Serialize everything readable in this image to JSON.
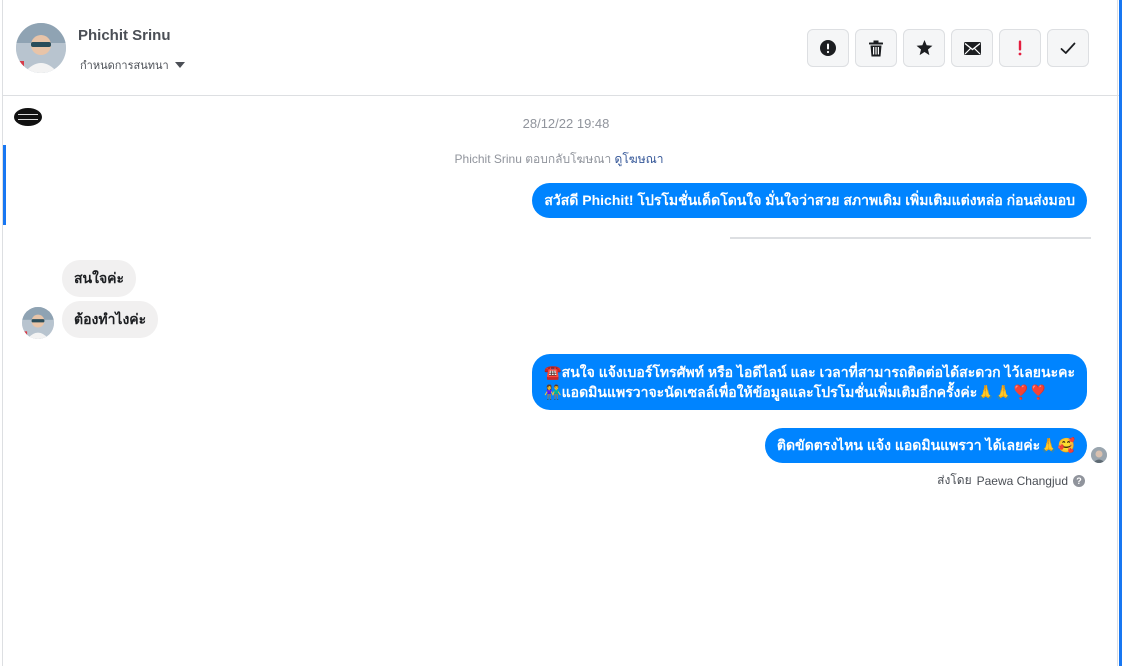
{
  "header": {
    "contact_name": "Phichit Srinu",
    "conversation_label": "กำหนดการสนทนา"
  },
  "toolbar": [
    {
      "name": "report-button",
      "icon": "exclamation-circle-icon"
    },
    {
      "name": "delete-button",
      "icon": "trash-icon"
    },
    {
      "name": "star-button",
      "icon": "star-icon"
    },
    {
      "name": "mark-unread-button",
      "icon": "envelope-icon"
    },
    {
      "name": "spam-button",
      "icon": "exclamation-icon",
      "color": "#e41e3f"
    },
    {
      "name": "mark-done-button",
      "icon": "checkmark-icon"
    }
  ],
  "thread": {
    "timestamp": "28/12/22 19:48",
    "ad_reply_prefix": "Phichit Srinu ตอบกลับโฆษณา",
    "ad_reply_link": "ดูโฆษณา",
    "messages": [
      {
        "direction": "out",
        "text": "สวัสดี Phichit! โปรโมชั่นเด็ดโดนใจ มั่นใจว่าสวย สภาพเดิม เพิ่มเติมแต่งหล่อ ก่อนส่งมอบ"
      },
      {
        "direction": "in",
        "text": "สนใจค่ะ"
      },
      {
        "direction": "in",
        "text": "ต้องทำไงค่ะ"
      },
      {
        "direction": "out",
        "line1": "☎️สนใจ แจ้งเบอร์โทรศัพท์ หรือ ไอดีไลน์  และ เวลาที่สามารถติดต่อได้สะดวก ไว้เลยนะคะ",
        "line2": "👫แอดมินแพรวาจะนัดเซลล์เพื่อให้ข้อมูลและโปรโมชั่นเพิ่มเติมอีกครั้งค่ะ🙏🙏❣️❣️"
      },
      {
        "direction": "out",
        "text": "ติดขัดตรงไหน แจ้ง แอดมินแพรวา ได้เลยค่ะ🙏🥰"
      }
    ],
    "sent_by_prefix": "ส่งโดย",
    "sent_by_name": "Paewa Changjud"
  },
  "colors": {
    "accent": "#1877f2",
    "outgoing_bubble": "#0084ff",
    "incoming_bubble": "#f1f0f0",
    "spam": "#e41e3f"
  }
}
